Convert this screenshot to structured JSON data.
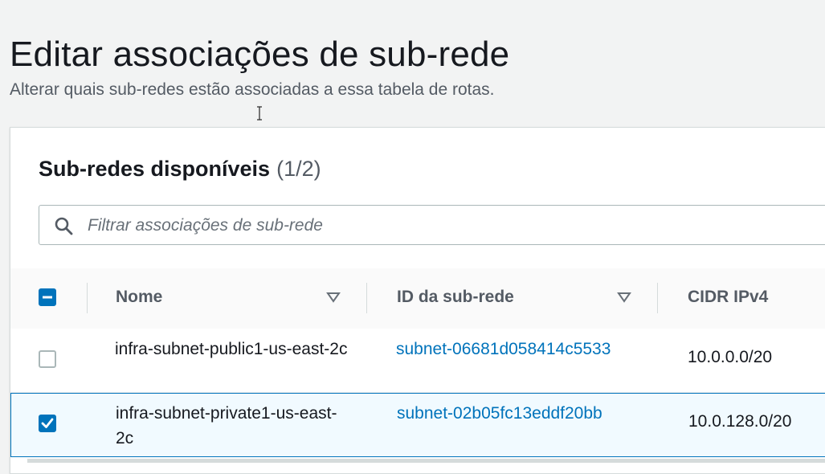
{
  "page": {
    "title": "Editar associações de sub-rede",
    "description": "Alterar quais sub-redes estão associadas a essa tabela de rotas."
  },
  "panel": {
    "heading": "Sub-redes disponíveis",
    "count": "(1/2)",
    "search": {
      "placeholder": "Filtrar associações de sub-rede",
      "value": "",
      "icon": "search-icon"
    }
  },
  "table": {
    "header_checkbox_state": "indeterminate",
    "columns": [
      {
        "label": "Nome",
        "sortable": true
      },
      {
        "label": "ID da sub-rede",
        "sortable": true
      },
      {
        "label": "CIDR IPv4",
        "sortable": false
      }
    ],
    "rows": [
      {
        "selected": false,
        "name": "infra-subnet-public1-us-east-2c",
        "subnet_id": "subnet-06681d058414c5533",
        "cidr": "10.0.0.0/20"
      },
      {
        "selected": true,
        "name": "infra-subnet-private1-us-east-2c",
        "subnet_id": "subnet-02b05fc13eddf20bb",
        "cidr": "10.0.128.0/20"
      }
    ]
  },
  "colors": {
    "accent": "#0073bb",
    "selected_row_bg": "#f1faff",
    "muted_text": "#545b64"
  }
}
